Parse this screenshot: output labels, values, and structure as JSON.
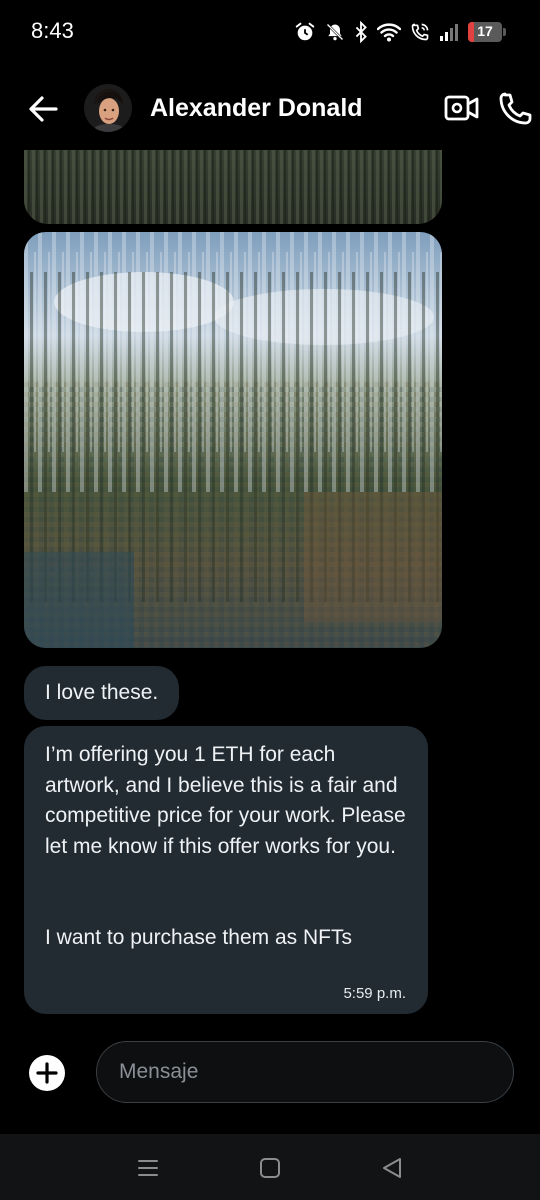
{
  "status_bar": {
    "time": "8:43",
    "battery_level": "17",
    "battery_fraction": 0.17,
    "battery_color": "#e0433f",
    "icons": [
      "alarm-icon",
      "bell-off-icon",
      "bluetooth-icon",
      "wifi-icon",
      "wifi-calling-icon",
      "signal-icon",
      "battery-icon"
    ]
  },
  "header": {
    "contact_name": "Alexander Donald",
    "back_icon": "arrow-left-icon",
    "video_icon": "video-camera-icon",
    "call_icon": "phone-icon"
  },
  "messages": [
    {
      "type": "image",
      "description_icon": "image-thumbnail"
    },
    {
      "type": "image",
      "description_icon": "image-thumbnail"
    },
    {
      "type": "text",
      "text": "I love these."
    },
    {
      "type": "text",
      "text": "I’m offering you 1 ETH for each artwork, and I believe this is a fair and competitive price for your work. Please let me know if this offer works for you.\n\n\nI want to purchase them as NFTs",
      "time": "5:59 p.m."
    }
  ],
  "composer": {
    "placeholder": "Mensaje",
    "add_icon": "plus-circle-icon"
  },
  "navbar": {
    "icons": [
      "menu-icon",
      "home-square-icon",
      "back-triangle-icon"
    ]
  },
  "colors": {
    "background": "#000000",
    "bubble": "#222b32",
    "input_border": "#3a3f44"
  }
}
